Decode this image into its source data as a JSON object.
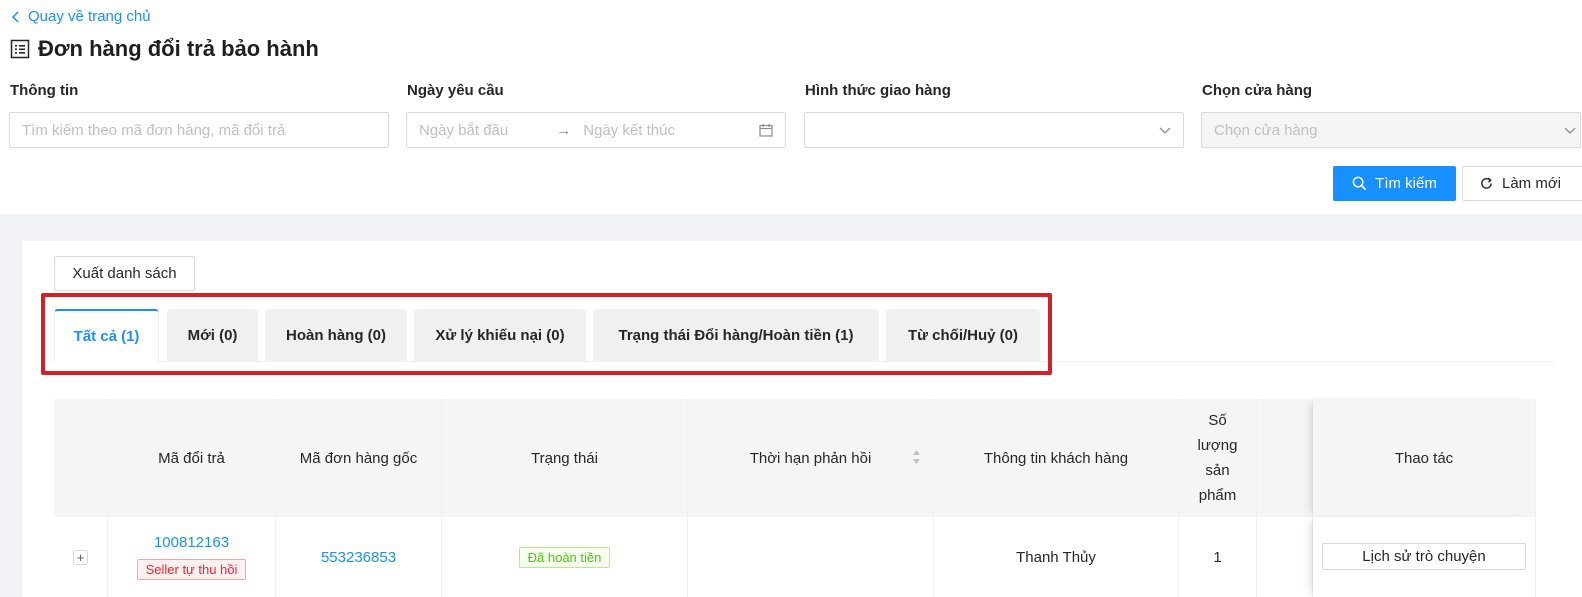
{
  "header": {
    "back_label": "Quay về trang chủ",
    "title": "Đơn hàng đổi trả bảo hành"
  },
  "filters": {
    "info_label": "Thông tin",
    "info_placeholder": "Tìm kiếm theo mã đơn hàng, mã đổi trả",
    "date_label": "Ngày yêu cầu",
    "date_start_placeholder": "Ngày bắt đầu",
    "date_end_placeholder": "Ngày kết thúc",
    "shipping_label": "Hình thức giao hàng",
    "shipping_value": "",
    "store_label": "Chọn cửa hàng",
    "store_placeholder": "Chọn cửa hàng",
    "search_button": "Tìm kiếm",
    "reset_button": "Làm mới"
  },
  "toolbar": {
    "export_button": "Xuất danh sách"
  },
  "tabs": [
    {
      "label": "Tất cả (1)",
      "active": true
    },
    {
      "label": "Mới (0)",
      "active": false
    },
    {
      "label": "Hoàn hàng (0)",
      "active": false
    },
    {
      "label": "Xử lý khiếu nại (0)",
      "active": false
    },
    {
      "label": "Trạng thái Đổi hàng/Hoàn tiền (1)",
      "active": false
    },
    {
      "label": "Từ chối/Huỷ (0)",
      "active": false
    }
  ],
  "table": {
    "columns": {
      "return_code": "Mã đổi trả",
      "order_code": "Mã đơn hàng gốc",
      "status": "Trạng thái",
      "deadline": "Thời hạn phản hồi",
      "customer": "Thông tin khách hàng",
      "quantity": "Số lượng sản phẩm",
      "actions": "Thao tác"
    },
    "rows": [
      {
        "expand": "+",
        "return_code": "100812163",
        "return_tag": "Seller tự thu hồi",
        "order_code": "553236853",
        "status": "Đã hoàn tiền",
        "deadline": "",
        "customer": "Thanh Thủy",
        "quantity": "1",
        "action_button": "Lịch sử trò chuyện"
      }
    ]
  },
  "colors": {
    "primary": "#1890ff",
    "highlight": "#d32029",
    "tag_red": "#f5222d",
    "tag_green": "#52c41a"
  }
}
